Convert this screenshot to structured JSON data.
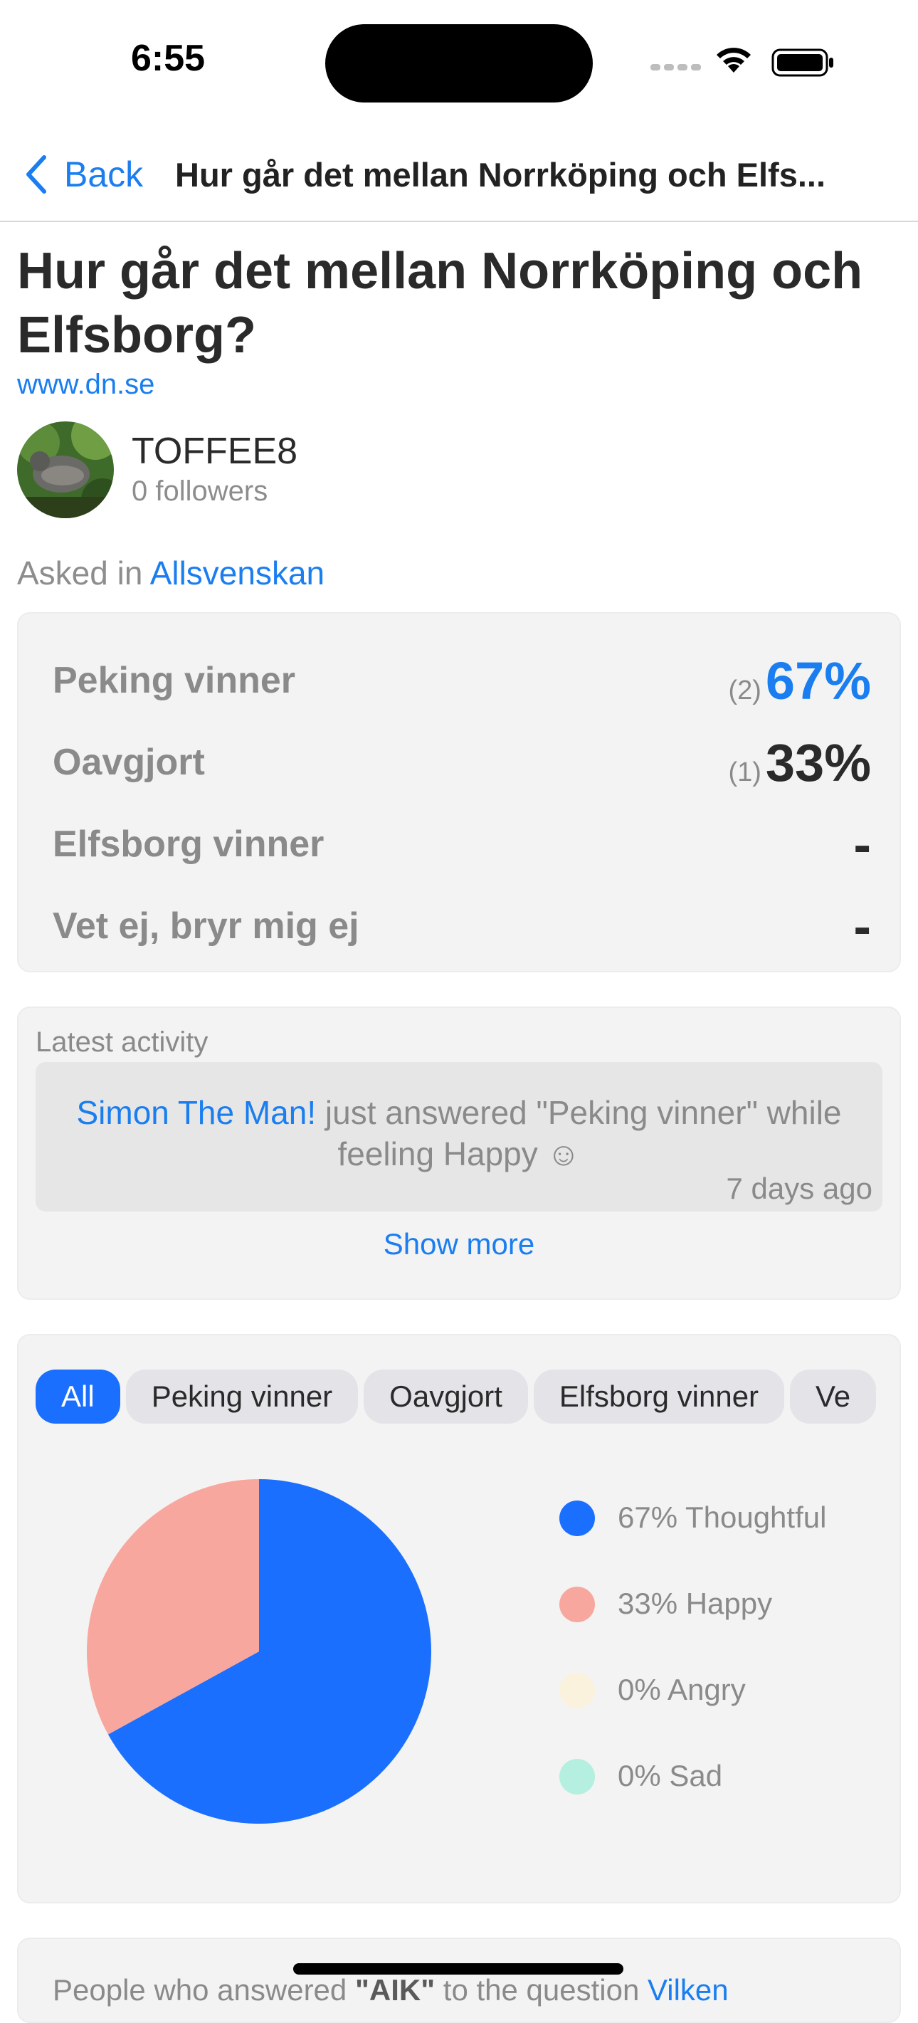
{
  "status_bar": {
    "time": "6:55"
  },
  "nav": {
    "back_label": "Back",
    "title": "Hur går det mellan Norrköping och Elfs..."
  },
  "question": {
    "title": "Hur går det mellan Norrköping och Elfsborg?",
    "source": "www.dn.se",
    "author": "TOFFEE8",
    "followers": "0 followers",
    "asked_prefix": "Asked in",
    "asked_category": "Allsvenskan"
  },
  "results": [
    {
      "label": "Peking vinner",
      "count": "(2)",
      "percent": "67%"
    },
    {
      "label": "Oavgjort",
      "count": "(1)",
      "percent": "33%"
    },
    {
      "label": "Elfsborg vinner",
      "count": "",
      "percent": "-"
    },
    {
      "label": "Vet ej, bryr mig ej",
      "count": "",
      "percent": "-"
    }
  ],
  "activity": {
    "heading": "Latest activity",
    "user": "Simon The Man!",
    "text": " just answered \"Peking vinner\" while feeling Happy ☺",
    "time": "7 days ago",
    "show_more": "Show more"
  },
  "filters": [
    "All",
    "Peking vinner",
    "Oavgjort",
    "Elfsborg vinner",
    "Ve"
  ],
  "chart_data": {
    "type": "pie",
    "series": [
      {
        "name": "Thoughtful",
        "label": "67% Thoughtful",
        "value": 67,
        "color": "#1a6fff"
      },
      {
        "name": "Happy",
        "label": "33% Happy",
        "value": 33,
        "color": "#f8a79e"
      },
      {
        "name": "Angry",
        "label": "0% Angry",
        "value": 0,
        "color": "#faf2dc"
      },
      {
        "name": "Sad",
        "label": "0% Sad",
        "value": 0,
        "color": "#b4efdf"
      }
    ]
  },
  "next_card": {
    "prefix": "People who answered ",
    "answer": "\"AIK\"",
    "middle": " to the question ",
    "link": "Vilken"
  }
}
